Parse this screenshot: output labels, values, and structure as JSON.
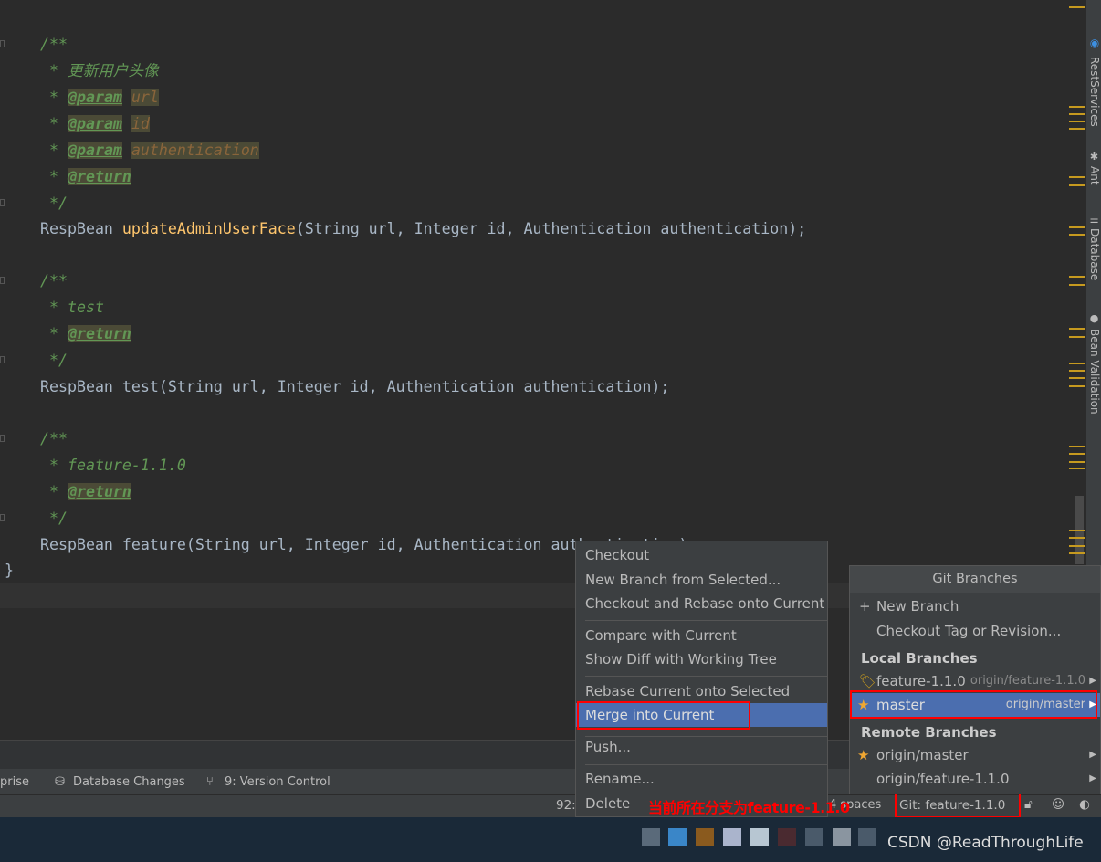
{
  "editor": {
    "lines": {
      "c1_open": "/**",
      "c1_desc": "更新用户头像",
      "param_tag": "@param",
      "return_tag": "@return",
      "p_url": "url",
      "p_id": "id",
      "p_auth": "authentication",
      "close": "*/",
      "star": " * ",
      "m1_type": "RespBean ",
      "m1_name": "updateAdminUserFace",
      "m1_args": "(String url, Integer id, Authentication authentication);",
      "c2_desc": "test",
      "m2_name": "test",
      "m2_args": "(String url, Integer id, Authentication authentication);",
      "c3_desc": "feature-1.1.0",
      "m3_name": "feature",
      "m3_args": "(String url, Integer id, Authentication authentication);",
      "brace": "}"
    },
    "marker_color": "#c69a1f"
  },
  "right_sidebar": [
    "RestServices",
    "Ant",
    "Database",
    "Bean Validation"
  ],
  "toolbar": {
    "enterprise_partial": "prise",
    "database_changes": "Database Changes",
    "version_control": "9: Version Control"
  },
  "status": {
    "line_col_partial": "92:",
    "indent_partial": "4 spaces",
    "git_branch": "Git: feature-1.1.0"
  },
  "annotation": "当前所在分支为feature-1.1.0",
  "context_menu": {
    "items": [
      "Checkout",
      "New Branch from Selected...",
      "Checkout and Rebase onto Current",
      "Compare with Current",
      "Show Diff with Working Tree",
      "Rebase Current onto Selected",
      "Merge into Current",
      "Push...",
      "Rename...",
      "Delete"
    ],
    "selected": "Merge into Current"
  },
  "git_branches": {
    "title": "Git Branches",
    "new_branch": "New Branch",
    "checkout_tag": "Checkout Tag or Revision...",
    "local_header": "Local Branches",
    "local": [
      {
        "name": "feature-1.1.0",
        "tracking": "origin/feature-1.1.0",
        "icon": "tag-icon"
      },
      {
        "name": "master",
        "tracking": "origin/master",
        "icon": "star-icon",
        "selected": true
      }
    ],
    "remote_header": "Remote Branches",
    "remote": [
      {
        "name": "origin/master",
        "icon": "star-icon"
      },
      {
        "name": "origin/feature-1.1.0"
      }
    ]
  },
  "watermark": "CSDN @ReadThroughLife",
  "colors": {
    "selection": "#4b6eaf",
    "highlight_box": "#ff0000",
    "annotation": "#ff0000"
  }
}
